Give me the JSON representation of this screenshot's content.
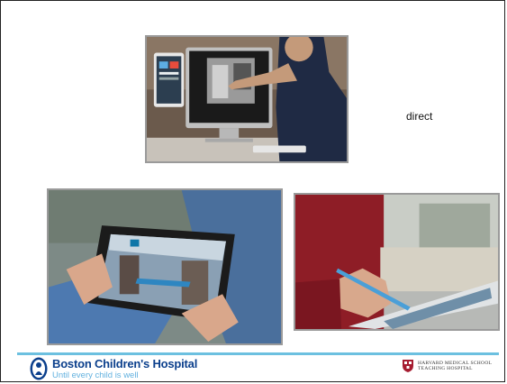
{
  "slide": {
    "caption": "direct"
  },
  "images": [
    {
      "subject": "person touching a large monitor next to a tablet"
    },
    {
      "subject": "hands holding a tablet showing a city street"
    },
    {
      "subject": "hand writing on a tablet with a stylus"
    }
  ],
  "footer": {
    "bch_name": "Boston Children's Hospital",
    "bch_tagline": "Until every child is well",
    "hms_line1": "HARVARD MEDICAL SCHOOL",
    "hms_line2": "TEACHING HOSPITAL",
    "colors": {
      "bch_blue": "#0b3f8c",
      "tagline_blue": "#62b1df",
      "rule": "#6cc0e0",
      "hms_crimson": "#a51c30"
    }
  }
}
